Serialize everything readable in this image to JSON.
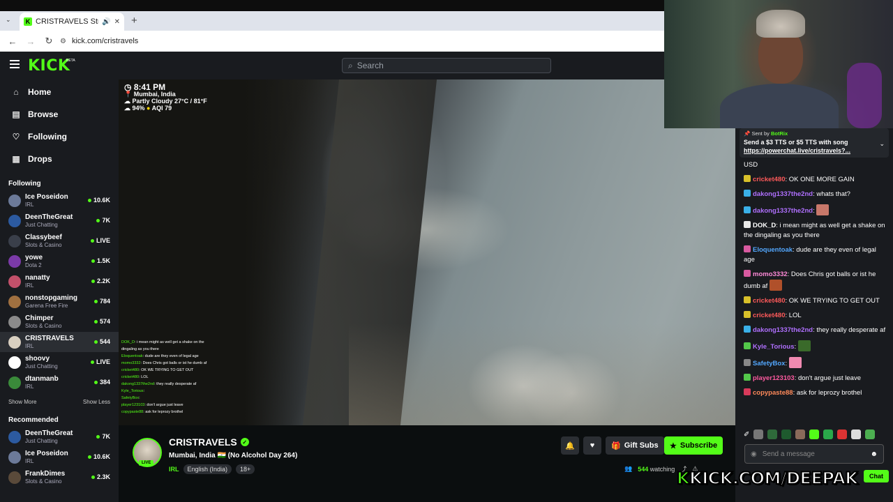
{
  "browser": {
    "tab_title": "CRISTRAVELS Stream - Watc",
    "url": "kick.com/cristravels"
  },
  "header": {
    "logo": "KICK",
    "beta": "BETA",
    "search_placeholder": "Search"
  },
  "sidebar": {
    "nav": [
      {
        "label": "Home",
        "icon": "home-icon"
      },
      {
        "label": "Browse",
        "icon": "browse-icon"
      },
      {
        "label": "Following",
        "icon": "heart-icon"
      },
      {
        "label": "Drops",
        "icon": "drops-icon"
      }
    ],
    "following_title": "Following",
    "following": [
      {
        "name": "Ice Poseidon",
        "category": "IRL",
        "viewers": "10.6K",
        "color": "#6c7a99"
      },
      {
        "name": "DeenTheGreat",
        "category": "Just Chatting",
        "viewers": "7K",
        "color": "#2c5aa0"
      },
      {
        "name": "Classybeef",
        "category": "Slots & Casino",
        "viewers": "LIVE",
        "color": "#3a3f4a"
      },
      {
        "name": "yowe",
        "category": "Dota 2",
        "viewers": "1.5K",
        "color": "#7b3aa8"
      },
      {
        "name": "nanatty",
        "category": "IRL",
        "viewers": "2.2K",
        "color": "#c2506a"
      },
      {
        "name": "nonstopgaming",
        "category": "Garena Free Fire",
        "viewers": "784",
        "color": "#a07040"
      },
      {
        "name": "Chimper",
        "category": "Slots & Casino",
        "viewers": "574",
        "color": "#8a8a8a"
      },
      {
        "name": "CRISTRAVELS",
        "category": "IRL",
        "viewers": "544",
        "color": "#d8cfc0"
      },
      {
        "name": "shoovy",
        "category": "Just Chatting",
        "viewers": "LIVE",
        "color": "#ffffff"
      },
      {
        "name": "dtanmanb",
        "category": "IRL",
        "viewers": "384",
        "color": "#3a8a3a"
      }
    ],
    "show_more": "Show More",
    "show_less": "Show Less",
    "recommended_title": "Recommended",
    "recommended": [
      {
        "name": "DeenTheGreat",
        "category": "Just Chatting",
        "viewers": "7K",
        "color": "#2c5aa0"
      },
      {
        "name": "Ice Poseidon",
        "category": "IRL",
        "viewers": "10.6K",
        "color": "#6c7a99"
      },
      {
        "name": "FrankDimes",
        "category": "Slots & Casino",
        "viewers": "2.3K",
        "color": "#5a4a3a"
      }
    ]
  },
  "video_overlay": {
    "time": "8:41 PM",
    "location": "Mumbai, India",
    "weather": "Partly Cloudy 27°C / 81°F",
    "humidity": "94%",
    "aqi": "AQI 79",
    "chat_lines": [
      {
        "user": "DOK_D",
        "text": ": i mean might as well get a shake on the"
      },
      {
        "user": "",
        "text": "dingaling as you there"
      },
      {
        "user": "Eloquentoak",
        "text": ": dude are they even of legal age"
      },
      {
        "user": "momo3332",
        "text": ": Does Chris got balls or ist he dumb af"
      },
      {
        "user": "cricket480",
        "text": ": OK WE TRYING TO GET OUT"
      },
      {
        "user": "cricket480",
        "text": ": LOL"
      },
      {
        "user": "dakong1337the2nd",
        "text": ": they really desperate af"
      },
      {
        "user": "Kyle_Torious",
        "text": ":"
      },
      {
        "user": "SafetyBox",
        "text": ":"
      },
      {
        "user": "player123103",
        "text": ": don't argue just leave"
      },
      {
        "user": "copypaste88",
        "text": ": ask for leprozy brothel"
      }
    ]
  },
  "stream_info": {
    "name": "CRISTRAVELS",
    "live": "LIVE",
    "title": "Mumbai, India 🇮🇳 (No Alcohol Day 264)",
    "category": "IRL",
    "tags": [
      "English (India)",
      "18+"
    ],
    "gift_subs": "Gift Subs",
    "subscribe": "Subscribe",
    "viewers": "544",
    "watching": "watching"
  },
  "chat": {
    "pinned_sent_by": "Sent by",
    "pinned_user": "BotRix",
    "pinned_text": "Send a $3 TTS or $5 TTS with song",
    "pinned_link": "https://powerchat.live/cristravels?...",
    "messages": [
      {
        "user": "",
        "text": "USD",
        "color": "#fff"
      },
      {
        "user": "cricket480",
        "text": ": OK ONE MORE GAIN",
        "color": "#ff5a5a"
      },
      {
        "user": "dakong1337the2nd",
        "text": ": whats that?",
        "color": "#b070ff"
      },
      {
        "user": "dakong1337the2nd",
        "text": ":",
        "color": "#b070ff"
      },
      {
        "user": "DOK_D",
        "text": ": i mean might as well get a shake on the dingaling as you there",
        "color": "#ffffff"
      },
      {
        "user": "Eloquentoak",
        "text": ": dude are they even of legal age",
        "color": "#53a8ff"
      },
      {
        "user": "momo3332",
        "text": ": Does Chris got balls or ist he dumb af",
        "color": "#ff8ad8"
      },
      {
        "user": "cricket480",
        "text": ": OK WE TRYING TO GET OUT",
        "color": "#ff5a5a"
      },
      {
        "user": "cricket480",
        "text": ": LOL",
        "color": "#ff5a5a"
      },
      {
        "user": "dakong1337the2nd",
        "text": ": they really desperate af",
        "color": "#b070ff"
      },
      {
        "user": "Kyle_Torious",
        "text": ":",
        "color": "#b070ff"
      },
      {
        "user": "SafetyBox",
        "text": ":",
        "color": "#53a8ff"
      },
      {
        "user": "player123103",
        "text": ": don't argue just leave",
        "color": "#ff5aa0"
      },
      {
        "user": "copypaste88",
        "text": ": ask for leprozy brothel",
        "color": "#ff8a5a"
      }
    ],
    "input_placeholder": "Send a message",
    "chat_button": "Chat"
  },
  "watermark": "KICK.COM/DEEPAK",
  "colors": {
    "accent": "#53fc18",
    "bg": "#191b1f"
  }
}
